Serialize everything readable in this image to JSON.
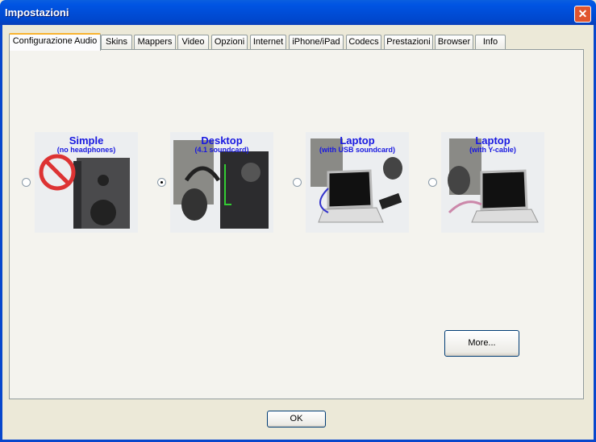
{
  "window": {
    "title": "Impostazioni"
  },
  "tabs": [
    "Configurazione Audio",
    "Skins",
    "Mappers",
    "Video",
    "Opzioni",
    "Internet",
    "iPhone/iPad",
    "Codecs",
    "Prestazioni",
    "Browser",
    "Info"
  ],
  "active_tab": "Configurazione Audio",
  "options": [
    {
      "title": "Simple",
      "subtitle": "(no headphones)",
      "selected": false
    },
    {
      "title": "Desktop",
      "subtitle": "(4.1 soundcard)",
      "selected": true
    },
    {
      "title": "Laptop",
      "subtitle": "(with USB soundcard)",
      "selected": false
    },
    {
      "title": "Laptop",
      "subtitle": "(with Y-cable)",
      "selected": false
    }
  ],
  "more_label": "More...",
  "ok_label": "OK"
}
